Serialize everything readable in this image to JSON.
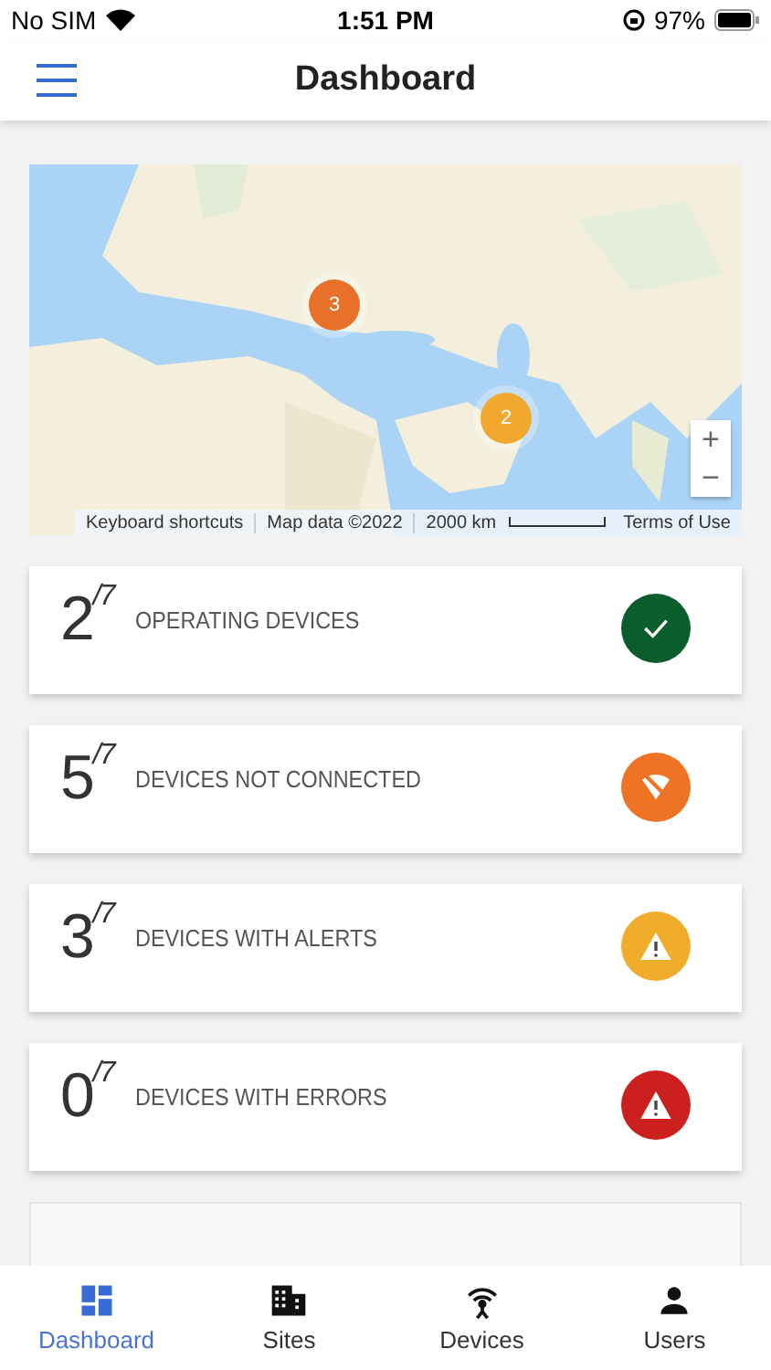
{
  "status_bar": {
    "carrier": "No SIM",
    "time": "1:51 PM",
    "battery": "97%"
  },
  "header": {
    "title": "Dashboard"
  },
  "map": {
    "kind": "picture",
    "clusters": [
      {
        "count": "3",
        "color": "#e8712a"
      },
      {
        "count": "2",
        "color": "#f0a92e"
      }
    ],
    "zoom_in": "+",
    "zoom_out": "−",
    "attribution": [
      "Keyboard shortcuts",
      "Map data ©2022"
    ],
    "scale": "2000 km",
    "terms": "Terms of Use"
  },
  "cards": [
    {
      "count": "2",
      "total": "/7",
      "label": "OPERATING DEVICES",
      "kind": "ok",
      "color": "#0b5e2b"
    },
    {
      "count": "5",
      "total": "/7",
      "label": "DEVICES NOT CONNECTED",
      "kind": "disconnected",
      "color": "#ee7324"
    },
    {
      "count": "3",
      "total": "/7",
      "label": "DEVICES WITH ALERTS",
      "kind": "alert",
      "color": "#f0ad2c"
    },
    {
      "count": "0",
      "total": "/7",
      "label": "DEVICES WITH ERRORS",
      "kind": "error",
      "color": "#cc1f1f"
    }
  ],
  "tabs": [
    {
      "label": "Dashboard",
      "kind": "dashboard",
      "selected": true
    },
    {
      "label": "Sites",
      "kind": "sites",
      "selected": false
    },
    {
      "label": "Devices",
      "kind": "devices",
      "selected": false
    },
    {
      "label": "Users",
      "kind": "users",
      "selected": false
    }
  ]
}
